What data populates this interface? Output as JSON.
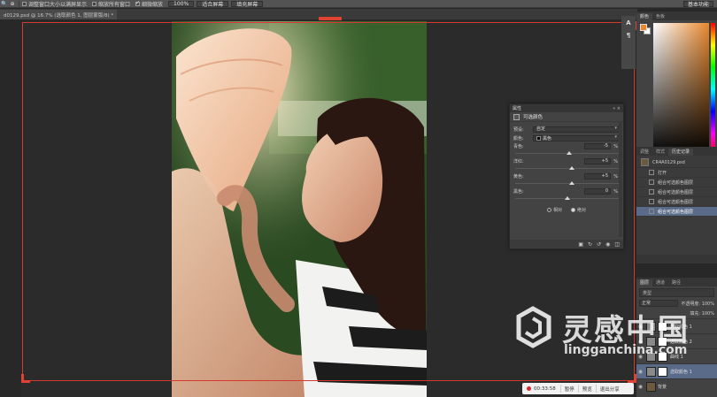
{
  "options_bar": {
    "zoom_icon": "magnifier-icon",
    "resize_windows_label": "调整窗口大小以满屏显示",
    "zoom_all_label": "缩放所有窗口",
    "scrubby_zoom_label": "细微缩放",
    "zoom_percent": "100%",
    "fit_screen_label": "适合屏幕",
    "fill_screen_label": "填充屏幕",
    "workspace_label": "基本功能"
  },
  "document": {
    "tab_label": "d0129.psd @ 16.7% (选取颜色 1, 图层蒙版/8) *"
  },
  "tools": {
    "type_tool": "A",
    "paragraph_tool": "¶"
  },
  "color_panel": {
    "tabs": [
      "颜色",
      "色板"
    ],
    "foreground": "#e8892f",
    "background": "#ffffff"
  },
  "history_panel": {
    "tabs": [
      "调整",
      "样式",
      "历史记录"
    ],
    "snapshot": "CR4A0129.psd",
    "items": [
      "打开",
      "组合可选颜色图层",
      "组合可选颜色图层",
      "组合可选颜色图层",
      "组合可选颜色图层"
    ],
    "selected_index": 4
  },
  "layers_panel": {
    "tabs": [
      "图层",
      "通道",
      "路径"
    ],
    "filter_label": "类型",
    "blend_mode": "正常",
    "opacity_label": "不透明度: 100%",
    "fill_label": "填充: 100%",
    "layers": [
      {
        "name": "选取颜色 1",
        "selected": false
      },
      {
        "name": "选取颜色 2",
        "selected": false
      },
      {
        "name": "曲线 1",
        "selected": false
      },
      {
        "name": "选取颜色 1",
        "selected": true
      },
      {
        "name": "背景",
        "selected": false
      }
    ]
  },
  "properties_panel": {
    "header": "属性",
    "title": "可选颜色",
    "preset_label": "预设:",
    "preset_value": "自定",
    "colors_label": "颜色:",
    "colors_value": "黑色",
    "sliders": [
      {
        "label": "青色:",
        "value": "-5",
        "unit": "%",
        "knob": 0.52
      },
      {
        "label": "洋红:",
        "value": "+5",
        "unit": "%",
        "knob": 0.55
      },
      {
        "label": "黄色:",
        "value": "+5",
        "unit": "%",
        "knob": 0.55
      },
      {
        "label": "黑色:",
        "value": "0",
        "unit": "%",
        "knob": 0.5
      }
    ],
    "method_relative": "相对",
    "method_absolute": "绝对",
    "method_selected": "绝对"
  },
  "recording_bar": {
    "time": "00:33:58",
    "pause_label": "暂停",
    "preview_label": "预览",
    "exit_label": "退出分享"
  },
  "watermark": {
    "chinese": "灵感中国",
    "domain": "lingganchina.com"
  }
}
